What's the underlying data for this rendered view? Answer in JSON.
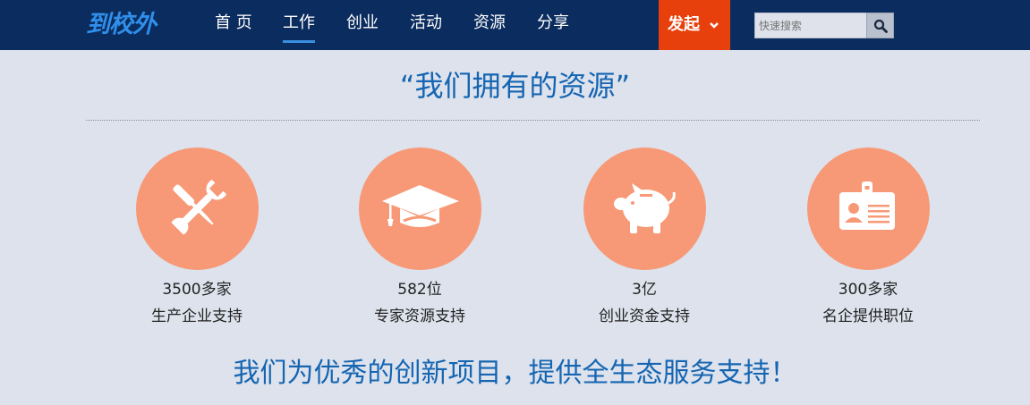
{
  "header": {
    "logo_text": "到校外",
    "nav": [
      {
        "label": "首 页"
      },
      {
        "label": "工作"
      },
      {
        "label": "创业"
      },
      {
        "label": "活动"
      },
      {
        "label": "资源"
      },
      {
        "label": "分享"
      }
    ],
    "active_nav": "工作",
    "launch_label": "发起",
    "search_placeholder": "快速搜索"
  },
  "main": {
    "title": "“我们拥有的资源”",
    "resources": [
      {
        "icon": "tools-icon",
        "count": "3500多家",
        "desc": "生产企业支持"
      },
      {
        "icon": "graduation-cap-icon",
        "count": "582位",
        "desc": "专家资源支持"
      },
      {
        "icon": "piggy-bank-icon",
        "count": "3亿",
        "desc": "创业资金支持"
      },
      {
        "icon": "id-card-icon",
        "count": "300多家",
        "desc": "名企提供职位"
      }
    ],
    "tagline": "我们为优秀的创新项目，提供全生态服务支持！"
  },
  "colors": {
    "nav_bg": "#0b2c5e",
    "accent_blue": "#1565b2",
    "launch_bg": "#e8400c",
    "circle": "#f79977",
    "page_bg": "#dde2ec"
  }
}
